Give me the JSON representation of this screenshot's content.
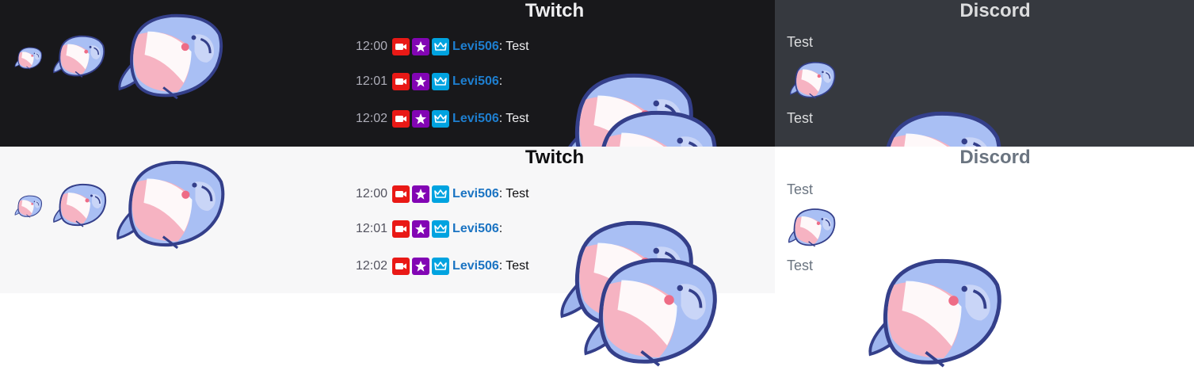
{
  "dark": {
    "twitch": {
      "title": "Twitch",
      "messages": [
        {
          "time": "12:00",
          "user": "Levi506",
          "colon": ":",
          "text": "Test",
          "emote": false
        },
        {
          "time": "12:01",
          "user": "Levi506",
          "colon": ":",
          "text": "",
          "emote": true
        },
        {
          "time": "12:02",
          "user": "Levi506",
          "colon": ":",
          "text": "Test",
          "emote": true
        }
      ]
    },
    "discord": {
      "title": "Discord",
      "messages": [
        "Test",
        "",
        "Test"
      ]
    }
  },
  "light": {
    "twitch": {
      "title": "Twitch",
      "messages": [
        {
          "time": "12:00",
          "user": "Levi506",
          "colon": ":",
          "text": "Test",
          "emote": false
        },
        {
          "time": "12:01",
          "user": "Levi506",
          "colon": ":",
          "text": "",
          "emote": true
        },
        {
          "time": "12:02",
          "user": "Levi506",
          "colon": ":",
          "text": "Test",
          "emote": true
        }
      ]
    },
    "discord": {
      "title": "Discord",
      "messages": [
        "Test",
        "",
        "Test"
      ]
    }
  },
  "icons": {
    "emote": "shark-emote-icon",
    "badge1": "camera-badge-icon",
    "badge2": "star-badge-icon",
    "badge3": "crown-badge-icon"
  },
  "colors": {
    "twitch_dark_bg": "#18181b",
    "discord_dark_bg": "#36393f",
    "twitch_light_bg": "#f7f7f8",
    "discord_light_bg": "#ffffff",
    "username": "#1e7fd0",
    "badge_camera": "#e91916",
    "badge_star": "#8205b4",
    "badge_crown": "#00a3e0"
  }
}
